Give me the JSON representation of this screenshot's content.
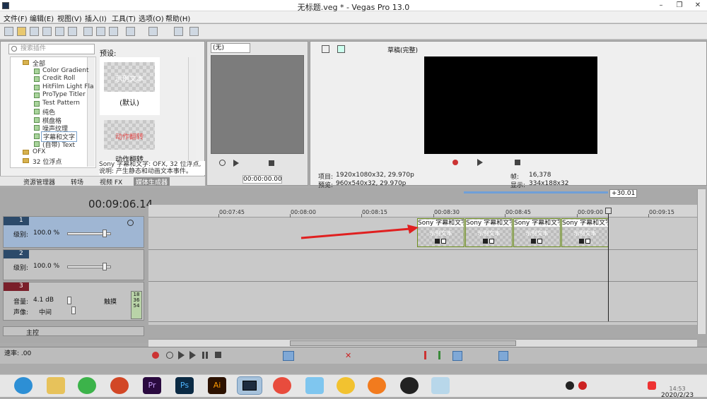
{
  "window": {
    "title": "无标题.veg * - Vegas Pro 13.0",
    "controls": [
      "–",
      "❐",
      "✕"
    ]
  },
  "menu": [
    "文件(F)",
    "编辑(E)",
    "视图(V)",
    "插入(I)",
    "工具(T)",
    "选项(O)",
    "帮助(H)"
  ],
  "media_panel": {
    "search_placeholder": "搜索插件",
    "tree": [
      {
        "label": "全部",
        "type": "folder"
      },
      {
        "label": "Color Gradient",
        "type": "leaf"
      },
      {
        "label": "Credit Roll",
        "type": "leaf"
      },
      {
        "label": "HitFilm Light Fla",
        "type": "leaf"
      },
      {
        "label": "ProType Titler",
        "type": "leaf"
      },
      {
        "label": "Test Pattern",
        "type": "leaf"
      },
      {
        "label": "纯色",
        "type": "leaf"
      },
      {
        "label": "棋盘格",
        "type": "leaf"
      },
      {
        "label": "噪声纹理",
        "type": "leaf"
      },
      {
        "label": "字幕和文字",
        "type": "leaf",
        "selected": true
      },
      {
        "label": "(自带) Text",
        "type": "leaf"
      },
      {
        "label": "OFX",
        "type": "folder"
      },
      {
        "label": "32 位浮点",
        "type": "folder"
      }
    ],
    "preset_label": "预设:",
    "presets": [
      {
        "thumb_text": "示例文本",
        "caption": "(默认)"
      },
      {
        "thumb_text": "动作翻转",
        "caption": "动作翻转"
      }
    ],
    "description_line1": "Sony 字幕和文字: OFX, 32 位浮点,",
    "description_line2": "说明: 产生静态和动画文本事件。",
    "tabs": [
      "资源管理器",
      "转场",
      "视频 FX",
      "媒体生成器"
    ],
    "active_tab": 3
  },
  "trimmer": {
    "select_value": "(无)",
    "time": "00:00:00.00"
  },
  "preview": {
    "quality": "草稿(完整)",
    "project_label": "项目:",
    "project_value": "1920x1080x32, 29.970p",
    "preview_label": "预览:",
    "preview_value": "960x540x32, 29.970p",
    "frame_label": "帧:",
    "frame_value": "16,378",
    "display_label": "显示:",
    "display_value": "334x188x32"
  },
  "timeline": {
    "timecode": "00:09:06.14",
    "loop_marker": "+30.01",
    "ticks": [
      "00:07:45",
      "00:08:00",
      "00:08:15",
      "00:08:30",
      "00:08:45",
      "00:09:00",
      "00:09:15"
    ],
    "tracks": [
      {
        "num": "1",
        "level_label": "级别:",
        "level_value": "100.0 %"
      },
      {
        "num": "2",
        "level_label": "级别:",
        "level_value": "100.0 %"
      },
      {
        "num": "3",
        "volume_label": "音量:",
        "volume_value": "4.1 dB",
        "pan_label": "声像:",
        "pan_value": "中间",
        "mode": "触摸",
        "meter": [
          "18",
          "36",
          "54"
        ]
      },
      {
        "num": "",
        "bus_label": "主控"
      }
    ],
    "clips": [
      {
        "label": "Sony 字幕和文字",
        "sub": "示例文本"
      },
      {
        "label": "Sony 字幕和文字",
        "sub": "示例文本"
      },
      {
        "label": "Sony 字幕和文字",
        "sub": "示例文本"
      },
      {
        "label": "Sony 字幕和文字",
        "sub": "示例文本"
      }
    ],
    "rate": "速率: .00"
  },
  "taskbar": {
    "apps": [
      "edge-icon",
      "explorer-icon",
      "wechat-icon",
      "powerpoint-icon",
      "premiere-icon",
      "photoshop-icon",
      "illustrator-icon",
      "vegas-icon",
      "app-icon",
      "app2-icon",
      "chrome-icon",
      "app3-icon",
      "qq-icon",
      "app4-icon"
    ],
    "time": "14:53",
    "date": "2020/2/23"
  }
}
